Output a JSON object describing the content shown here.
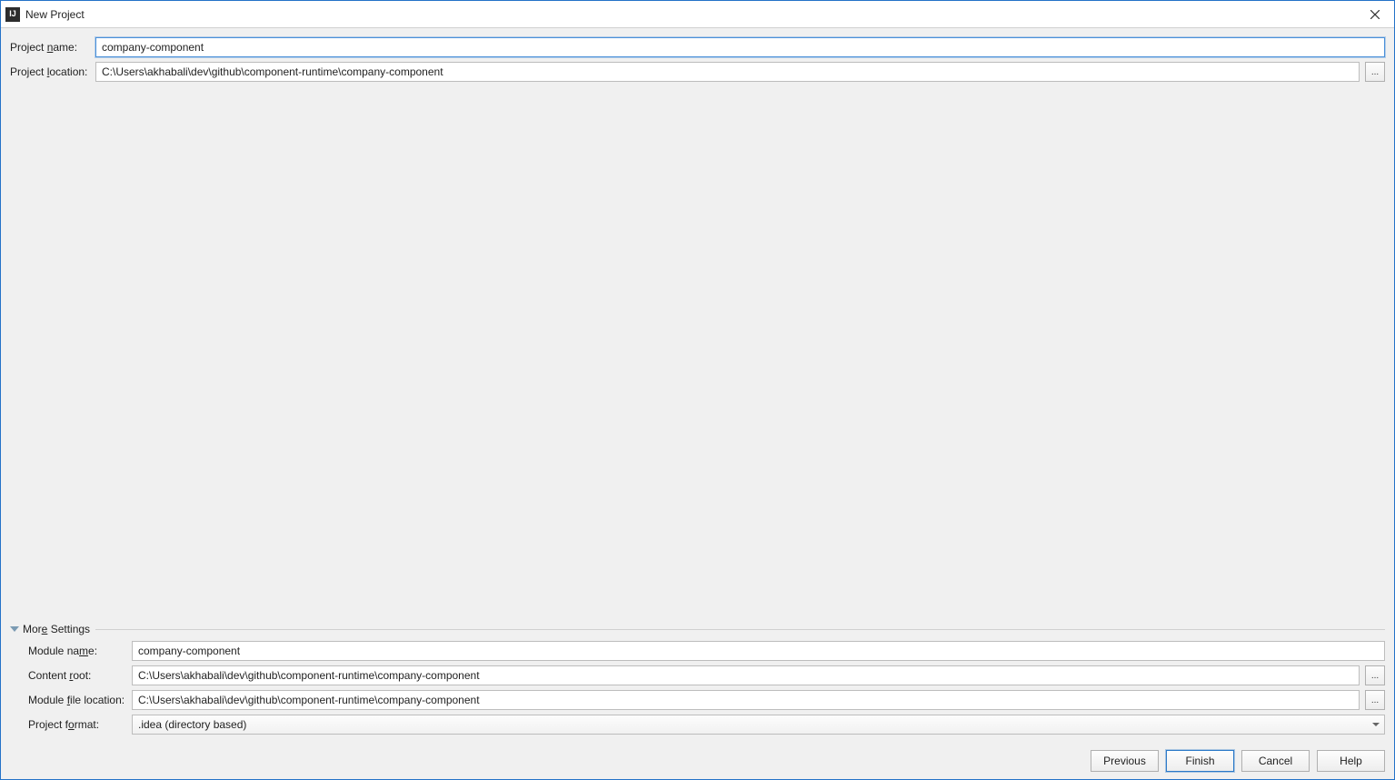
{
  "window": {
    "title": "New Project"
  },
  "top_form": {
    "project_name_label": "Project name:",
    "project_name_label_mnemonic_char": "n",
    "project_name_value": "company-component",
    "project_location_label": "Project location:",
    "project_location_label_mnemonic_char": "l",
    "project_location_value": "C:\\Users\\akhabali\\dev\\github\\component-runtime\\company-component",
    "browse_label": "..."
  },
  "section": {
    "title": "More Settings",
    "title_mnemonic_char": "e"
  },
  "more_settings": {
    "module_name_label": "Module name:",
    "module_name_label_mnemonic_char": "m",
    "module_name_value": "company-component",
    "content_root_label": "Content root:",
    "content_root_label_mnemonic_char": "r",
    "content_root_value": "C:\\Users\\akhabali\\dev\\github\\component-runtime\\company-component",
    "module_file_loc_label": "Module file location:",
    "module_file_loc_label_mnemonic_char": "f",
    "module_file_loc_value": "C:\\Users\\akhabali\\dev\\github\\component-runtime\\company-component",
    "project_format_label": "Project format:",
    "project_format_label_mnemonic_char": "o",
    "project_format_value": ".idea (directory based)",
    "browse_label": "..."
  },
  "buttons": {
    "previous": "Previous",
    "finish": "Finish",
    "cancel": "Cancel",
    "help": "Help"
  }
}
